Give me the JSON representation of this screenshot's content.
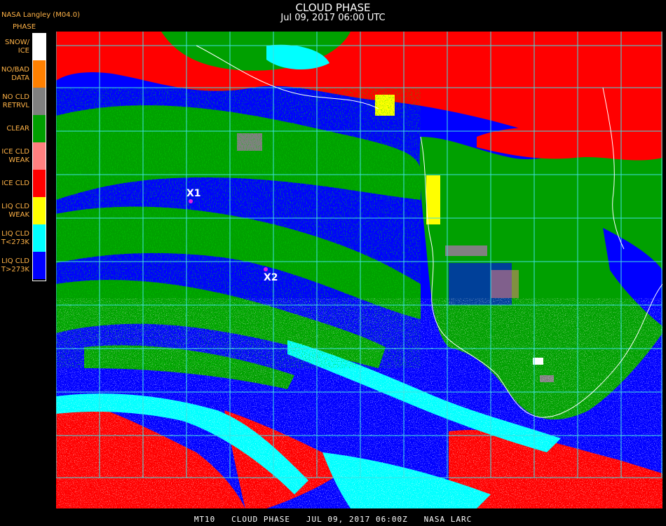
{
  "header": {
    "title": "CLOUD PHASE",
    "subtitle": "Jul 09, 2017 06:00 UTC",
    "source": "NASA Langley (M04.0)"
  },
  "legend": {
    "title": "PHASE",
    "items": [
      {
        "line1": "SNOW/",
        "line2": "ICE",
        "color": "#ffffff"
      },
      {
        "line1": "NO/BAD",
        "line2": "DATA",
        "color": "#ff8000"
      },
      {
        "line1": "NO CLD",
        "line2": "RETRVL",
        "color": "#808080"
      },
      {
        "line1": "CLEAR",
        "line2": "",
        "color": "#00a000"
      },
      {
        "line1": "ICE CLD",
        "line2": "WEAK",
        "color": "#ff8080"
      },
      {
        "line1": "ICE CLD",
        "line2": "",
        "color": "#ff0000"
      },
      {
        "line1": "LIQ CLD",
        "line2": "WEAK",
        "color": "#ffff00"
      },
      {
        "line1": "LIQ CLD",
        "line2": "T<273K",
        "color": "#00ffff"
      },
      {
        "line1": "LIQ CLD",
        "line2": "T>273K",
        "color": "#0000ff"
      }
    ]
  },
  "markers": [
    {
      "label": "X1"
    },
    {
      "label": "X2"
    }
  ],
  "footer": "MT10   CLOUD PHASE   JUL 09, 2017 06:00Z   NASA LARC"
}
